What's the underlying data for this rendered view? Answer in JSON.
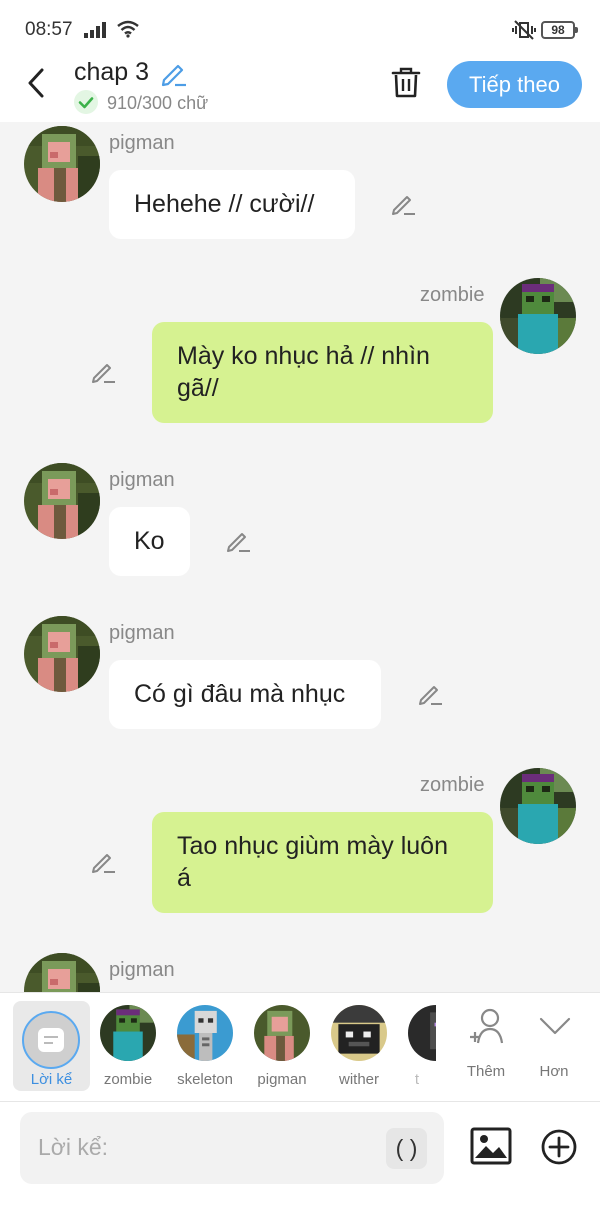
{
  "status_bar": {
    "time": "08:57",
    "battery": "98"
  },
  "header": {
    "title": "chap 3",
    "word_count": "910/300 chữ",
    "next_button": "Tiếp theo"
  },
  "messages": [
    {
      "sender": "pigman",
      "text": "Hehehe // cười//",
      "side": "left"
    },
    {
      "sender": "zombie",
      "text": "Mày ko nhục hả // nhìn gã//",
      "side": "right"
    },
    {
      "sender": "pigman",
      "text": "Ko",
      "side": "left"
    },
    {
      "sender": "pigman",
      "text": "Có gì đâu mà nhục",
      "side": "left"
    },
    {
      "sender": "zombie",
      "text": "Tao nhục giùm mày luôn á",
      "side": "right"
    },
    {
      "sender": "pigman",
      "text": "",
      "side": "left"
    }
  ],
  "characters": {
    "narrator_label": "Lời kể",
    "items": [
      {
        "label": "zombie"
      },
      {
        "label": "skeleton"
      },
      {
        "label": "pigman"
      },
      {
        "label": "wither"
      },
      {
        "label": "t"
      }
    ],
    "add_label": "Thêm",
    "more_label": "Hơn"
  },
  "input": {
    "placeholder": "Lời kể:",
    "paren_label": "( )"
  },
  "colors": {
    "accent": "#5aa9f0",
    "right_bubble": "#d6f291",
    "left_bubble": "#ffffff"
  }
}
